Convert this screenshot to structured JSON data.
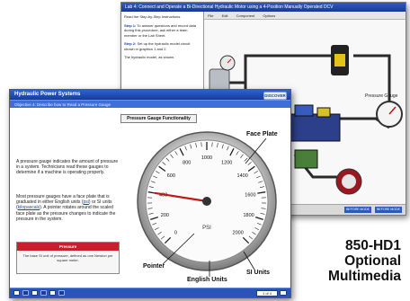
{
  "back_window": {
    "title": "Lab 4: Connect and Operate a Bi-Directional Hydraulic Motor using a 4-Position Manually Operated DCV",
    "intro": "Read the Step-by-Step Instructions.",
    "step1_title": "Step 1:",
    "step1_text": "To answer questions and record data during this procedure, ask either a team member or the Lab Sheet.",
    "step2_title": "Step 2:",
    "step2_text": "Set up the hydraulic model circuit shown in graphics 1 and 2.",
    "step3_text": "The hydraulic model, as shown.",
    "menu": [
      "File",
      "Edit",
      "Component",
      "Options"
    ],
    "status_buttons": [
      "BEFORE MODE",
      "BEFORE MODE"
    ],
    "label_pressure_gauge": "Pressure Gauge"
  },
  "front_window": {
    "title": "Hydraulic Power Systems",
    "subtitle": "Objective 4: Describe how to Read a Pressure Gauge",
    "logo": "DISCOVER",
    "topic_button": "Pressure Gauge Functionality",
    "paragraph1": "A pressure gauge indicates the amount of pressure in a system. Technicians read these gauges to determine if a machine is operating properly.",
    "paragraph2_parts": [
      "Most pressure gauges have a face plate that is graduated in either English units (",
      "psi",
      ") or SI units (",
      "kilopascals",
      "). A pointer rotates around the scaled face plate as the pressure changes to indicate the pressure in the system."
    ],
    "note_label": "Pressure",
    "note_text": "The base SI unit of pressure, defined as one Newton per square meter.",
    "callouts": {
      "face_plate": "Face Plate",
      "pointer": "Pointer",
      "english_units": "English Units",
      "si_units": "SI Units"
    },
    "gauge": {
      "psi_ticks": [
        "0",
        "200",
        "400",
        "600",
        "800",
        "1000",
        "1200",
        "1400",
        "1600",
        "1800",
        "2000"
      ],
      "psi_value": 400,
      "unit_label": "PSI"
    },
    "pager": "1 of 4"
  },
  "caption": {
    "line1": "850-HD1",
    "line2": "Optional",
    "line3": "Multimedia"
  },
  "colors": {
    "titlebar_blue": "#1f47ad",
    "note_red": "#c6202a",
    "link_blue": "#1c3cc8"
  }
}
